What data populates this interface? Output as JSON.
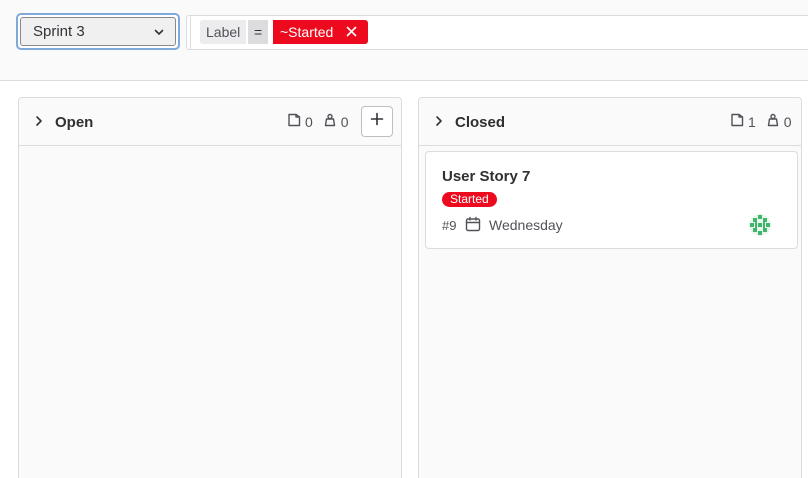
{
  "sprint_select": {
    "value": "Sprint 3"
  },
  "filter": {
    "token_label": "Label",
    "token_operator": "=",
    "token_value": "~Started",
    "token_color": "#ee0a1e"
  },
  "columns": [
    {
      "title": "Open",
      "issue_count": "0",
      "weight_count": "0"
    },
    {
      "title": "Closed",
      "issue_count": "1",
      "weight_count": "0"
    }
  ],
  "card": {
    "title": "User Story 7",
    "badge": "Started",
    "badge_color": "#ee0a1e",
    "reference": "#9",
    "due_date": "Wednesday"
  },
  "icons": {
    "chevron": "chevron-down-icon",
    "collapse": "chevron-right-icon",
    "issues": "issues-icon",
    "weight": "weight-icon",
    "add": "plus-icon",
    "close": "close-icon",
    "calendar": "calendar-icon"
  }
}
